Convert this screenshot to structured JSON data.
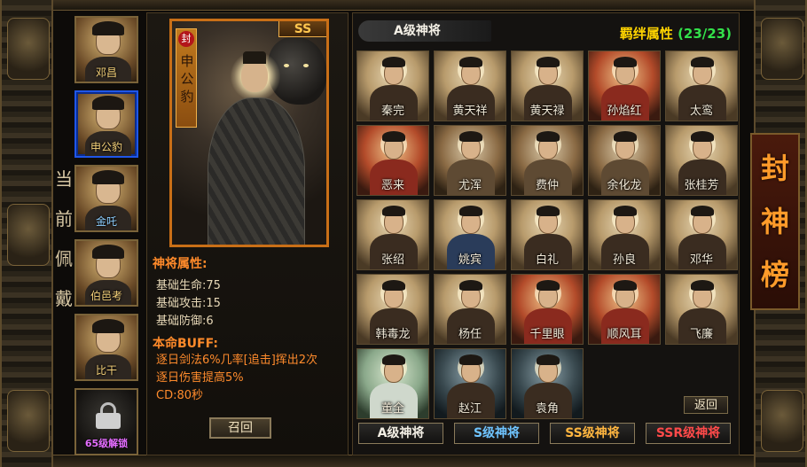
{
  "equipped": {
    "side_label": [
      "当",
      "前",
      "佩",
      "戴"
    ],
    "slots": [
      {
        "name": "邓昌",
        "style": "gold"
      },
      {
        "name": "申公豹",
        "style": "gold",
        "selected": true
      },
      {
        "name": "金吒",
        "style": "blue"
      },
      {
        "name": "伯邑考",
        "style": "gold"
      },
      {
        "name": "比干",
        "style": "gold"
      }
    ],
    "locked_slot": {
      "text": "65级解锁"
    }
  },
  "detail": {
    "card": {
      "seal": "封",
      "name": "申公豹",
      "grade": "SS"
    },
    "attr_title": "神将属性:",
    "attrs": [
      {
        "label": "基础生命:",
        "value": "75"
      },
      {
        "label": "基础攻击:",
        "value": "15"
      },
      {
        "label": "基础防御:",
        "value": "6"
      }
    ],
    "buff_title": "本命BUFF:",
    "buff_lines": [
      "逐日剑法6%几率[追击]挥出2次",
      "逐日伤害提高5%",
      "CD:80秒"
    ],
    "recall_button": "召回"
  },
  "list": {
    "tab_label": "A级神将",
    "bond_label": "羁绊属性",
    "bond_value": "(23/23)",
    "generals": [
      {
        "name": "秦完",
        "style": ""
      },
      {
        "name": "黄天祥",
        "style": ""
      },
      {
        "name": "黄天禄",
        "style": ""
      },
      {
        "name": "孙焰红",
        "style": "red"
      },
      {
        "name": "太鸾",
        "style": ""
      },
      {
        "name": "恶来",
        "style": "red"
      },
      {
        "name": "尤浑",
        "style": "brown"
      },
      {
        "name": "费仲",
        "style": "brown"
      },
      {
        "name": "余化龙",
        "style": "brown"
      },
      {
        "name": "张桂芳",
        "style": ""
      },
      {
        "name": "张绍",
        "style": ""
      },
      {
        "name": "姚宾",
        "style": "blue"
      },
      {
        "name": "白礼",
        "style": ""
      },
      {
        "name": "孙良",
        "style": ""
      },
      {
        "name": "邓华",
        "style": ""
      },
      {
        "name": "韩毒龙",
        "style": ""
      },
      {
        "name": "杨任",
        "style": ""
      },
      {
        "name": "千里眼",
        "style": "red"
      },
      {
        "name": "顺风耳",
        "style": "red"
      },
      {
        "name": "飞廉",
        "style": ""
      },
      {
        "name": "董全",
        "style": "green"
      },
      {
        "name": "赵江",
        "style": "dark"
      },
      {
        "name": "袁角",
        "style": "dark"
      }
    ],
    "back_button": "返回",
    "tiers": [
      {
        "label": "A级神将",
        "color": "#f4f0e6"
      },
      {
        "label": "S级神将",
        "color": "#6fc4ff"
      },
      {
        "label": "SS级神将",
        "color": "#ffb640"
      },
      {
        "label": "SSR级神将",
        "color": "#ff4a4a"
      }
    ]
  },
  "side_title": [
    "封",
    "神",
    "榜"
  ]
}
